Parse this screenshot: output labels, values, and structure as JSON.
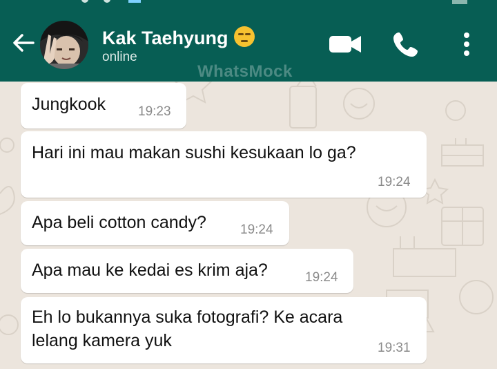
{
  "app": {
    "watermark": "WhatsMock"
  },
  "contact": {
    "name": "Kak Taehyung",
    "status": "online",
    "emoji": "expressionless-face-emoji"
  },
  "colors": {
    "header": "#075e54",
    "chat_background": "#ece5dd",
    "bubble": "#ffffff",
    "timestamp": "#8a8a8a"
  },
  "icons": {
    "back": "arrow-left-icon",
    "video": "video-camera-icon",
    "call": "phone-icon",
    "menu": "more-vertical-icon"
  },
  "messages": [
    {
      "text": "Jungkook",
      "time": "19:23"
    },
    {
      "text": "Hari ini mau makan sushi kesukaan lo ga?",
      "time": "19:24"
    },
    {
      "text": "Apa beli cotton candy?",
      "time": "19:24"
    },
    {
      "text": "Apa mau ke kedai es krim aja?",
      "time": "19:24"
    },
    {
      "text_lines": [
        "Eh lo bukannya suka fotografi? Ke acara",
        "lelang kamera yuk"
      ],
      "time": "19:31"
    }
  ]
}
